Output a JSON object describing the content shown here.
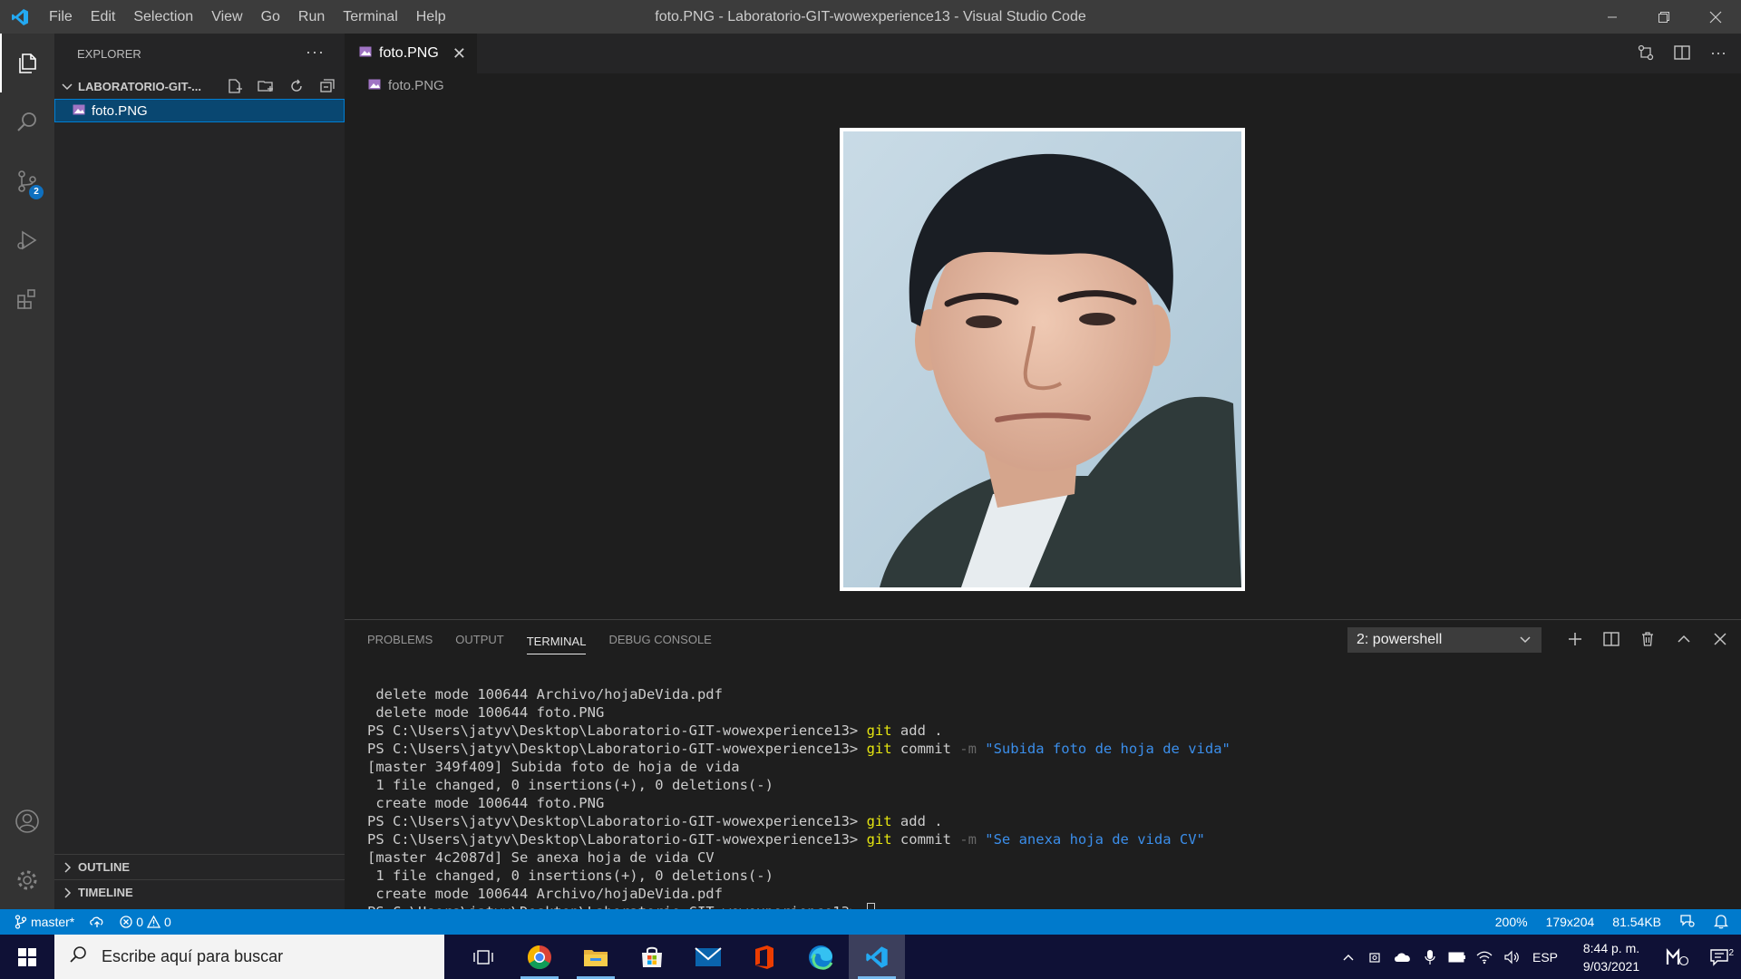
{
  "window": {
    "title": "foto.PNG - Laboratorio-GIT-wowexperience13 - Visual Studio Code",
    "menu": [
      "File",
      "Edit",
      "Selection",
      "View",
      "Go",
      "Run",
      "Terminal",
      "Help"
    ]
  },
  "activity_bar": {
    "source_control_badge": "2"
  },
  "sidebar": {
    "header": "EXPLORER",
    "more": "···",
    "folder": "LABORATORIO-GIT-...",
    "files": [
      "foto.PNG"
    ],
    "outline": "OUTLINE",
    "timeline": "TIMELINE"
  },
  "editor": {
    "tab_label": "foto.PNG",
    "breadcrumb": "foto.PNG"
  },
  "panel": {
    "tabs": [
      "PROBLEMS",
      "OUTPUT",
      "TERMINAL",
      "DEBUG CONSOLE"
    ],
    "active_tab": "TERMINAL",
    "terminal_select": "2: powershell",
    "lines": {
      "l1": " delete mode 100644 Archivo/hojaDeVida.pdf",
      "l2": " delete mode 100644 foto.PNG",
      "prompt": "PS C:\\Users\\jatyv\\Desktop\\Laboratorio-GIT-wowexperience13> ",
      "git": "git",
      "add_args": " add .",
      "commit": " commit ",
      "flag": "-m",
      "msg1": "\"Subida foto de hoja de vida\"",
      "l5": "[master 349f409] Subida foto de hoja de vida",
      "l6": " 1 file changed, 0 insertions(+), 0 deletions(-)",
      "l7": " create mode 100644 foto.PNG",
      "msg2": "\"Se anexa hoja de vida CV\"",
      "l10": "[master 4c2087d] Se anexa hoja de vida CV",
      "l11": " 1 file changed, 0 insertions(+), 0 deletions(-)",
      "l12": " create mode 100644 Archivo/hojaDeVida.pdf"
    }
  },
  "status_bar": {
    "branch": "master*",
    "errors": "0",
    "warnings": "0",
    "zoom": "200%",
    "dimensions": "179x204",
    "size": "81.54KB"
  },
  "taskbar": {
    "search_placeholder": "Escribe aquí para buscar",
    "language": "ESP",
    "time": "8:44 p. m.",
    "date": "9/03/2021",
    "notification_count": "2"
  },
  "colors": {
    "accent": "#007acc",
    "titlebar": "#3c3c3c",
    "activitybar": "#333333",
    "sidebar": "#252526",
    "editor": "#1e1e1e",
    "taskbar": "#0f1136"
  }
}
